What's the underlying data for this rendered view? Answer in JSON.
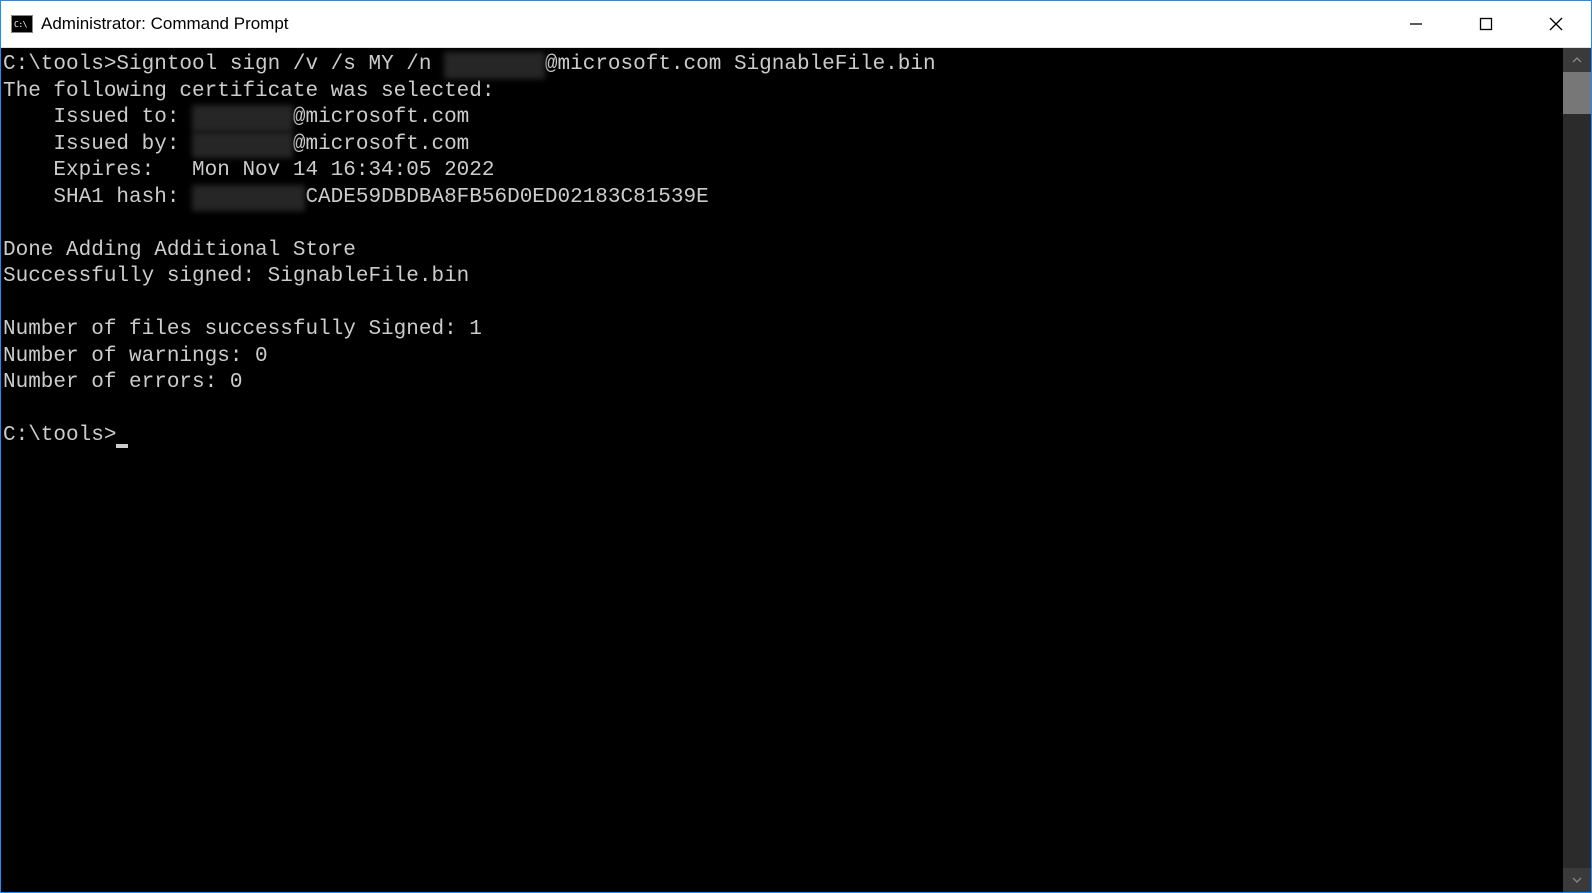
{
  "window": {
    "title": "Administrator: Command Prompt",
    "app_icon_label": "cmd-icon"
  },
  "console": {
    "prompt1_path": "C:\\tools>",
    "command": "Signtool sign /v /s MY /n ",
    "command_redacted": "xxxxxxxx",
    "command_email_suffix": "@microsoft.com",
    "command_file": " SignableFile.bin",
    "line_cert_selected": "The following certificate was selected:",
    "issued_to_label": "    Issued to: ",
    "issued_to_redacted": "xxxxxxxx",
    "issued_to_suffix": "@microsoft.com",
    "issued_by_label": "    Issued by: ",
    "issued_by_redacted": "xxxxxxxx",
    "issued_by_suffix": "@microsoft.com",
    "expires_label": "    Expires:   ",
    "expires_value": "Mon Nov 14 16:34:05 2022",
    "sha1_label": "    SHA1 hash: ",
    "sha1_redacted": "XXXXXXXXX",
    "sha1_suffix": "CADE59DBDBA8FB56D0ED02183C81539E",
    "done_store": "Done Adding Additional Store",
    "success_signed": "Successfully signed: SignableFile.bin",
    "num_signed": "Number of files successfully Signed: 1",
    "num_warnings": "Number of warnings: 0",
    "num_errors": "Number of errors: 0",
    "prompt2_path": "C:\\tools>"
  }
}
